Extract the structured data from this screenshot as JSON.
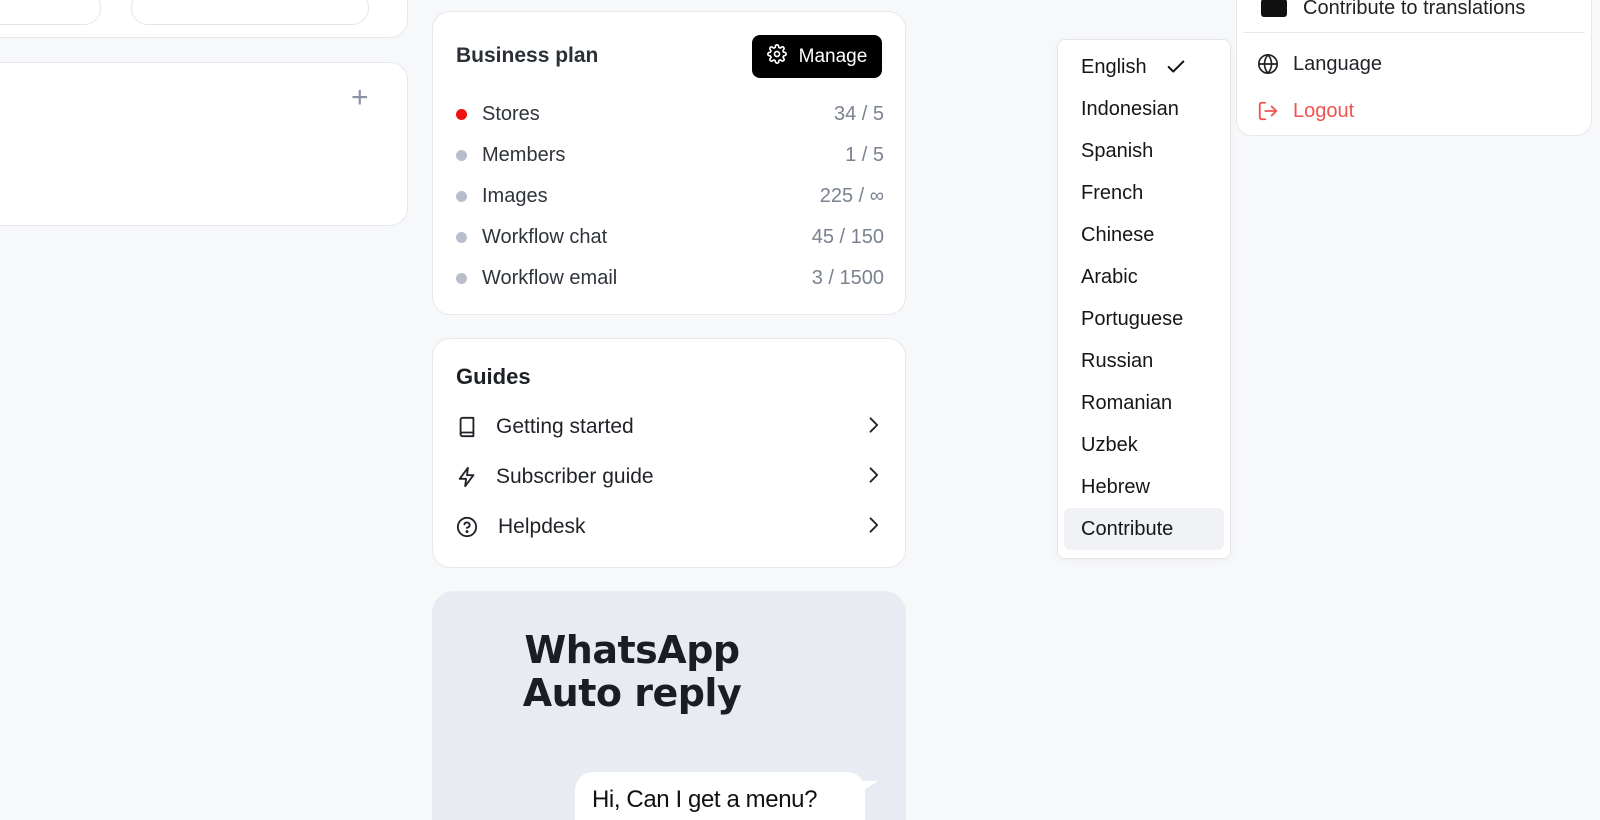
{
  "left_panel": {
    "add_icon": "plus-icon"
  },
  "plan": {
    "title": "Business plan",
    "manage_label": "Manage",
    "manage_icon": "gear-icon",
    "alert_color": "#ee1111",
    "rows": [
      {
        "name": "Stores",
        "value": "34 / 5",
        "status": "over-limit"
      },
      {
        "name": "Members",
        "value": "1 / 5",
        "status": "ok"
      },
      {
        "name": "Images",
        "value": "225 / ∞",
        "status": "ok"
      },
      {
        "name": "Workflow chat",
        "value": "45 / 150",
        "status": "ok"
      },
      {
        "name": "Workflow email",
        "value": "3 / 1500",
        "status": "ok"
      }
    ]
  },
  "guides": {
    "title": "Guides",
    "items": [
      {
        "label": "Getting started",
        "icon": "book-icon"
      },
      {
        "label": "Subscriber guide",
        "icon": "lightning-icon"
      },
      {
        "label": "Helpdesk",
        "icon": "help-circle-icon"
      }
    ]
  },
  "promo": {
    "headline_line1": "WhatsApp",
    "headline_line2": "Auto reply",
    "bubble_text": "Hi, Can I get a menu?"
  },
  "language_menu": {
    "selected": "English",
    "highlighted": "Contribute",
    "items": [
      "English",
      "Indonesian",
      "Spanish",
      "French",
      "Chinese",
      "Arabic",
      "Portuguese",
      "Russian",
      "Romanian",
      "Uzbek",
      "Hebrew",
      "Contribute"
    ]
  },
  "account_menu": {
    "contribute_label": "Contribute to translations",
    "language_label": "Language",
    "logout_label": "Logout",
    "logout_color": "#ef5350"
  }
}
